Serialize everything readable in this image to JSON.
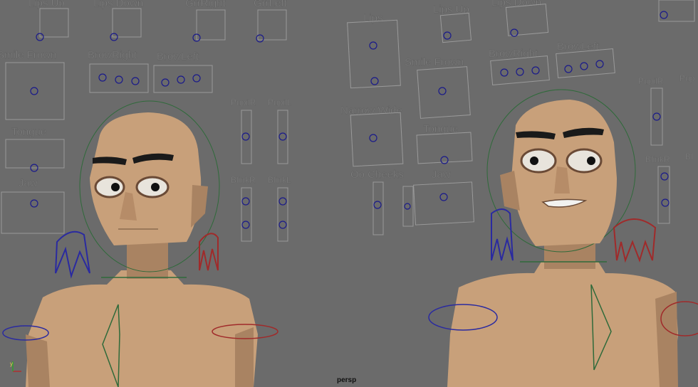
{
  "viewport": {
    "camera_label": "persp"
  },
  "left_rig": {
    "labels": {
      "lips_up": "Lips Up",
      "lips_down": "Lips Down",
      "grr_right": "GrrRight",
      "grr_left": "GrrLeft",
      "smile_frown": "Smile Frown",
      "brow_right": "BrowRight",
      "brow_left": "BrowLeft",
      "pupil_r": "PupilR",
      "pupil_l": "PupilL",
      "tongue": "Tongue",
      "blink_r": "BlinkR",
      "blink_l": "BlinkL",
      "jaw": "Jaw"
    }
  },
  "right_rig": {
    "labels": {
      "lips": "Lips",
      "lips_up": "Lips Up",
      "lips_down": "Lips Down",
      "smile_frown": "Smile Frown",
      "brow_right": "BrowRight",
      "brow_left": "BrowLeft",
      "pupil_r": "PupilR",
      "pupil_l": "Pup",
      "narrow_wide": "Narrow Wide",
      "tongue": "Tongue",
      "blink_r": "BlinkR",
      "blink_l": "Bl",
      "oo_cheeks": "Oo Cheeks",
      "jaw": "Jaw"
    }
  },
  "colors": {
    "background": "#6b6b6b",
    "skin": "#c8a07a",
    "control_knob": "#1a1a8a",
    "head_ring": "#2f6a3a",
    "arrow_blue": "#2a2aa0",
    "arrow_red": "#a02a2a"
  }
}
